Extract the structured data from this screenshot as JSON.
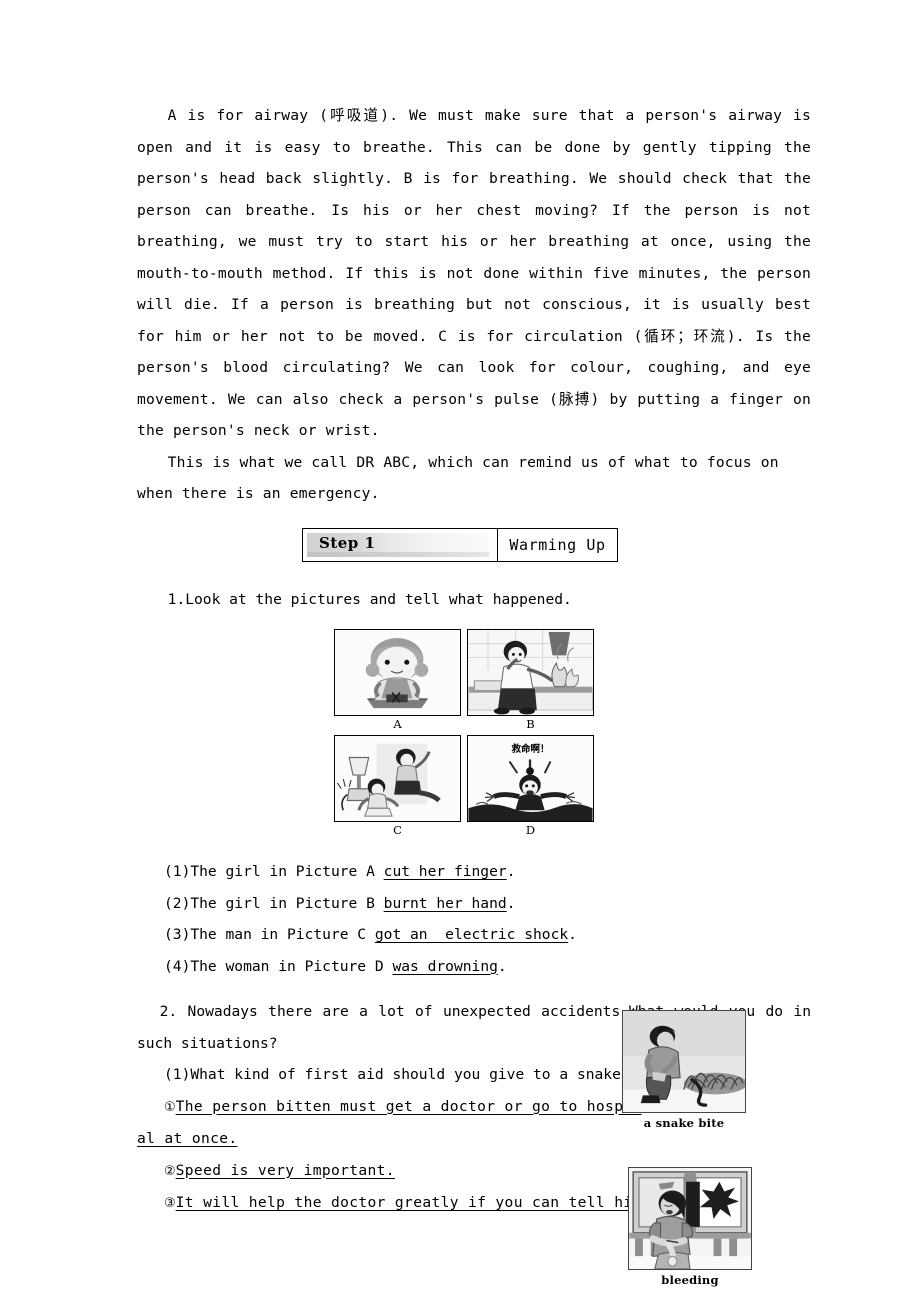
{
  "document": {
    "paragraphs": [
      "A is for airway (呼吸道). We must make sure that a person's airway is open and it is easy to breathe. This can be done by gently tipping the person's head back slightly. B is for breathing. We should check that the person can breathe. Is his or her chest moving? If the person is not breathing, we must try to start his or her breathing at once, using the mouth-to-mouth method. If this is not done within five minutes, the person will die. If a person is breathing but not conscious, it is usually best for him or her not to be moved. C is for circulation (循环；环流). Is the person's blood circulating? We can look for colour, coughing, and eye movement. We can also check a person's pulse (脉搏) by putting a finger on the person's neck or wrist.",
      "This is what we call DR ABC, which can remind us of what to focus on when there is an emergency."
    ]
  },
  "step_banner": {
    "step_label": "Step 1",
    "title": "Warming Up"
  },
  "task1": {
    "prompt": "1.Look at the pictures and tell what happened.",
    "pictures": [
      {
        "label": "A",
        "alt": "girl cutting her finger while using scissors",
        "shout": ""
      },
      {
        "label": "B",
        "alt": "girl at a stove with flames burning her hand",
        "shout": ""
      },
      {
        "label": "C",
        "alt": "man getting an electric shock from a lamp and wiring",
        "shout": ""
      },
      {
        "label": "D",
        "alt": "woman drowning in water calling for help",
        "shout": "救命啊！"
      }
    ],
    "answers": [
      {
        "num": "(1)",
        "lead": "The girl in Picture A ",
        "answer": "cut her finger",
        "tail": "."
      },
      {
        "num": "(2)",
        "lead": "The girl in Picture B ",
        "answer": "burnt her hand",
        "tail": "."
      },
      {
        "num": "(3)",
        "lead": "The man in Picture C ",
        "answer": "got an  electric shock",
        "tail": "."
      },
      {
        "num": "(4)",
        "lead": "The woman in Picture D ",
        "answer": "was drowning",
        "tail": "."
      }
    ]
  },
  "task2": {
    "prompt": "2. Nowadays there are a lot of unexpected accidents.What would you do in such situations?",
    "question": "(1)What kind of first aid should you give to a snake bite?",
    "answers": [
      {
        "num": "①",
        "line1": "The person bitten must get a doctor or go to hospit",
        "line2": "al at once."
      },
      {
        "num": "②",
        "line1": "Speed is very important.",
        "line2": ""
      },
      {
        "num": "③",
        "line1": "It will help the doctor greatly if you can tell him",
        "line2": ""
      }
    ]
  },
  "figures": [
    {
      "caption": "a snake bite",
      "alt": "person crouching in grass bitten by a snake"
    },
    {
      "caption": "bleeding",
      "alt": "woman with a bleeding arm near a broken window"
    }
  ]
}
